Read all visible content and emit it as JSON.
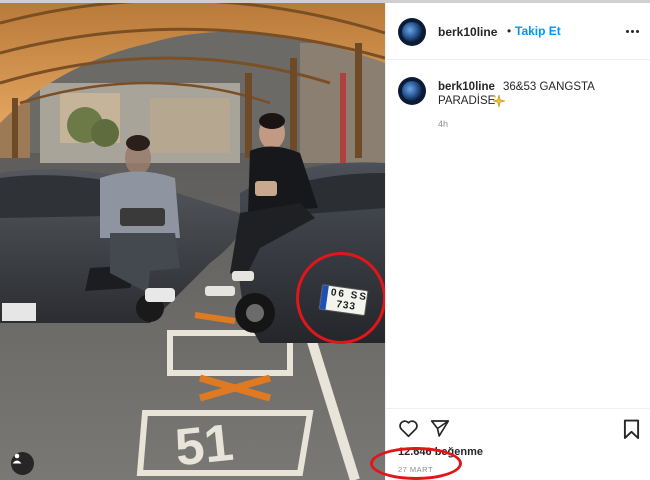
{
  "post": {
    "username": "berk10line",
    "separator": "•",
    "follow_label": "Takip Et",
    "more_icon": "more-dots-icon"
  },
  "photo": {
    "plate_line1": "06 SS",
    "plate_line2": "733",
    "user_tag_icon": "user-tag-icon"
  },
  "caption": {
    "username": "berk10line",
    "text_line1": "36&53 GANGSTA",
    "text_line2": "PARADİSE",
    "emoji_icon": "sparkle-emoji-icon",
    "time": "4h"
  },
  "actions": {
    "like_icon": "heart-icon",
    "share_icon": "paper-plane-icon",
    "save_icon": "bookmark-icon",
    "likes_text": "12.646 beğenme",
    "date": "27 MART"
  },
  "colors": {
    "accent": "#0095f6",
    "annotation_red": "#e0161b",
    "text": "#262626",
    "muted": "#8e8e8e"
  }
}
